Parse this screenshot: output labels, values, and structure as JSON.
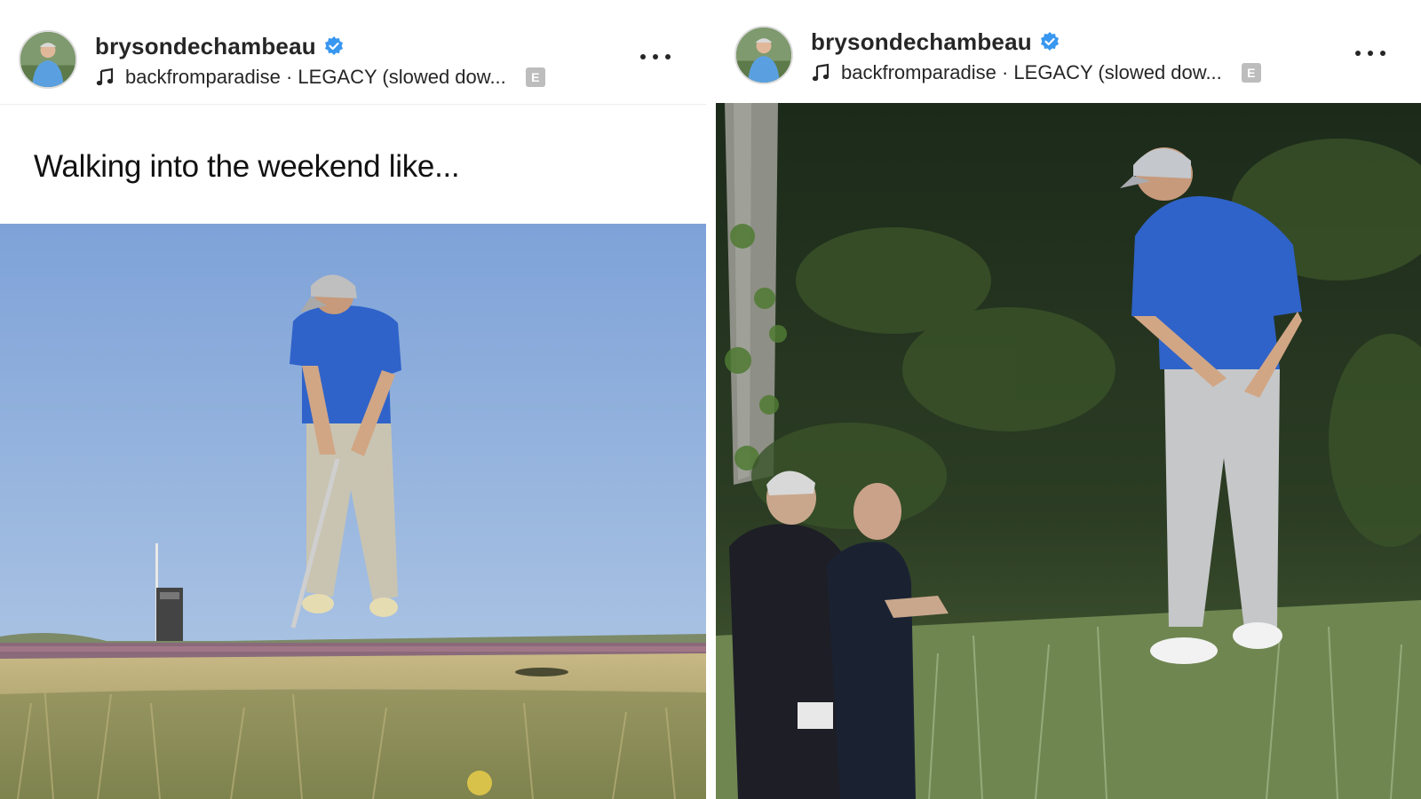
{
  "posts": [
    {
      "username": "brysondechambeau",
      "audio": "backfromparadise · LEGACY (slowed dow...",
      "explicit_badge": "E",
      "caption": "Walking into the weekend like...",
      "icons": {
        "verified": "verified-badge-icon",
        "audio": "music-note-icon",
        "more": "more-options-icon"
      }
    },
    {
      "username": "brysondechambeau",
      "audio": "backfromparadise · LEGACY (slowed dow...",
      "explicit_badge": "E",
      "icons": {
        "verified": "verified-badge-icon",
        "audio": "music-note-icon",
        "more": "more-options-icon"
      }
    }
  ],
  "colors": {
    "verified_blue": "#3897f0",
    "text": "#262626",
    "sky": "#8fb0dc",
    "shirt_blue": "#2f63c9"
  }
}
